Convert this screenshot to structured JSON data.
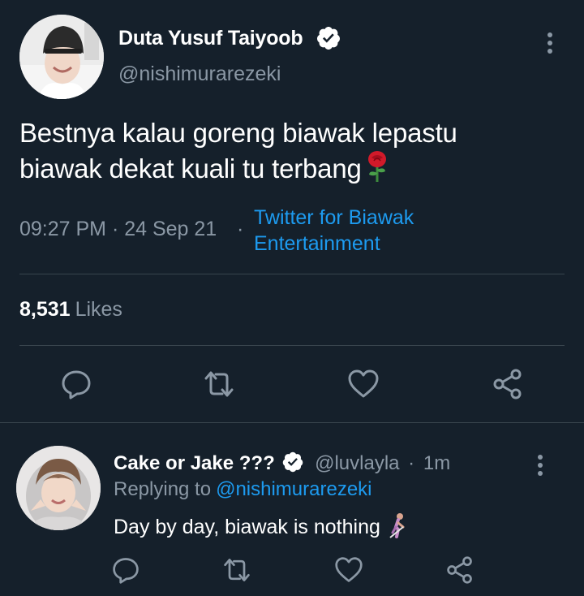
{
  "tweet": {
    "author_name": "Duta Yusuf Taiyoob",
    "handle": "@nishimurarezeki",
    "text_lines": [
      "Bestnya kalau goreng biawak lepastu",
      "biawak dekat kuali tu terbang"
    ],
    "emoji": "rose-emoji",
    "time": "09:27 PM · 24 Sep 21",
    "dot": "·",
    "source_lines": [
      "Twitter for Biawak",
      "Entertainment"
    ],
    "likes_count": "8,531",
    "likes_label": "Likes"
  },
  "reply": {
    "author_name": "Cake or Jake ???",
    "handle": "@luvlayla",
    "dot": "·",
    "time": "1m",
    "replying_label": "Replying to",
    "replying_handle": "@nishimurarezeki",
    "text": "Day by day, biawak is nothing",
    "emoji": "person-with-cane-emoji"
  },
  "icons": {
    "verified": "verified-badge-icon",
    "more": "more-vertical-icon",
    "reply": "reply-icon",
    "retweet": "retweet-icon",
    "like": "heart-icon",
    "share": "share-icon"
  },
  "colors": {
    "background": "#15202b",
    "secondary_text": "#8b98a5",
    "link": "#1d9bf0",
    "divider": "#38444d",
    "icon": "#8b98a5"
  }
}
